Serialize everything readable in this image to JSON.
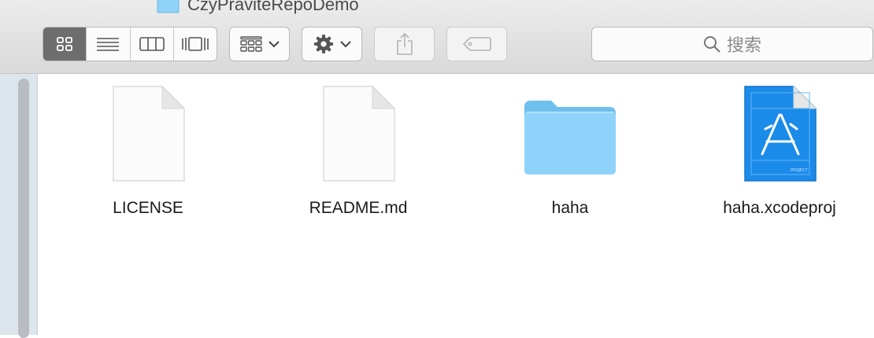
{
  "window": {
    "title": "CzyPraviteRepoDemo",
    "title_icon": "folder-icon"
  },
  "toolbar": {
    "view_modes": [
      {
        "name": "icon-view",
        "icon": "grid-icon",
        "active": true
      },
      {
        "name": "list-view",
        "icon": "list-icon",
        "active": false
      },
      {
        "name": "column-view",
        "icon": "columns-icon",
        "active": false
      },
      {
        "name": "cover-flow-view",
        "icon": "cover-flow-icon",
        "active": false
      }
    ],
    "arrange_icon": "arrange-icon",
    "action_icon": "gear-icon",
    "share_icon": "share-icon",
    "tags_icon": "tag-icon"
  },
  "search": {
    "placeholder": "搜索",
    "icon": "search-icon"
  },
  "files": [
    {
      "name": "LICENSE",
      "kind": "document"
    },
    {
      "name": "README.md",
      "kind": "document"
    },
    {
      "name": "haha",
      "kind": "folder"
    },
    {
      "name": "haha.xcodeproj",
      "kind": "xcode-project"
    }
  ],
  "colors": {
    "folder": "#7ccbf7",
    "xcode_blue": "#1b8bea",
    "selected_segment": "#6d6d6d",
    "sidebar": "#dde5ed"
  }
}
